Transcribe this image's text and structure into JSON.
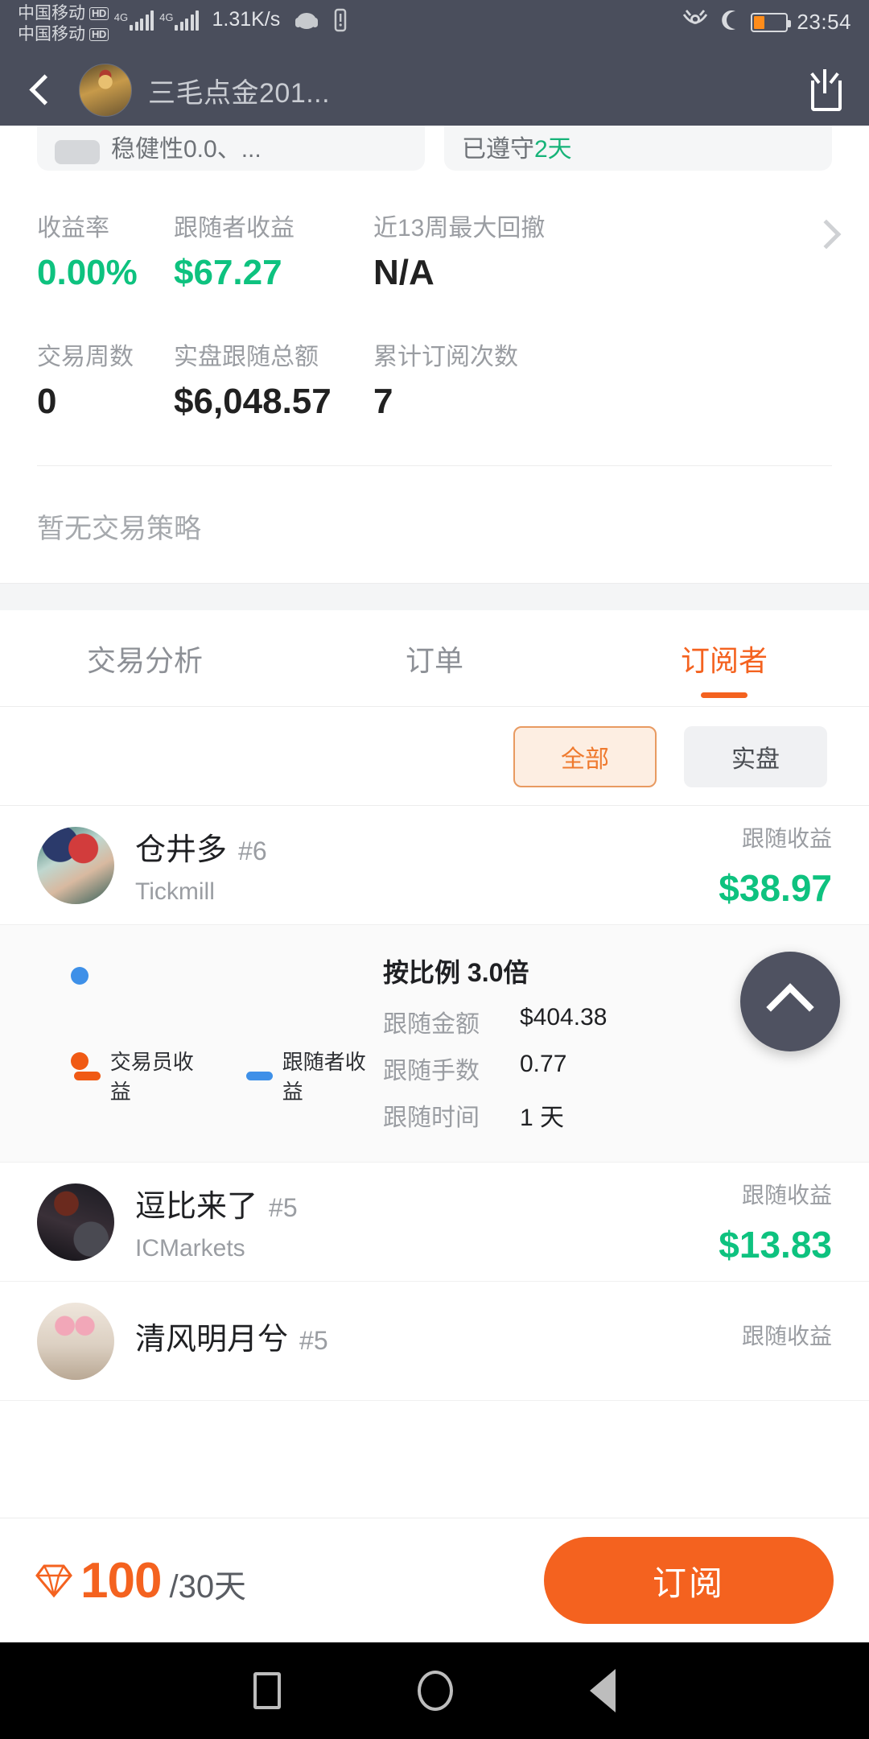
{
  "status_bar": {
    "carrier_1": "中国移动",
    "carrier_2": "中国移动",
    "hd_badge": "HD",
    "net_type_1": "4G",
    "net_type_2": "4G",
    "network_speed": "1.31K/s",
    "clock": "23:54",
    "icons": [
      "headset-icon",
      "vibrate-icon",
      "eye-icon",
      "moon-icon",
      "battery-icon"
    ]
  },
  "app_bar": {
    "title": "三毛点金201...",
    "back_icon": "back-chevron-icon",
    "share_icon": "share-icon",
    "avatar": "trader-avatar"
  },
  "pill_cards": [
    {
      "text": "稳健性0.0、...",
      "accent": ""
    },
    {
      "prefix": "已遵守",
      "accent": "2天"
    }
  ],
  "stats": {
    "row1": [
      {
        "label": "收益率",
        "value": "0.00%",
        "green": true
      },
      {
        "label": "跟随者收益",
        "value": "$67.27",
        "green": true
      },
      {
        "label": "近13周最大回撤",
        "value": "N/A",
        "green": false
      }
    ],
    "row2": [
      {
        "label": "交易周数",
        "value": "0",
        "green": false
      },
      {
        "label": "实盘跟随总额",
        "value": "$6,048.57",
        "green": false
      },
      {
        "label": "累计订阅次数",
        "value": "7",
        "green": false
      }
    ],
    "chevron_icon": "chevron-right-icon"
  },
  "empty_strategy": "暂无交易策略",
  "tabs": [
    {
      "label": "交易分析",
      "active": false
    },
    {
      "label": "订单",
      "active": false
    },
    {
      "label": "订阅者",
      "active": true
    }
  ],
  "filter_chips": [
    {
      "label": "全部",
      "active": true
    },
    {
      "label": "实盘",
      "active": false
    }
  ],
  "subscribers": [
    {
      "name": "仓井多",
      "rank": "#6",
      "broker": "Tickmill",
      "pl_label": "跟随收益",
      "pl_value": "$38.97",
      "expanded": true,
      "detail": {
        "title": "按比例 3.0倍",
        "lines": [
          {
            "label": "跟随金额",
            "value": "$404.38"
          },
          {
            "label": "跟随手数",
            "value": "0.77"
          },
          {
            "label": "跟随时间",
            "value": "1 天"
          }
        ],
        "legend": [
          {
            "label": "交易员收益",
            "color": "#f05a14"
          },
          {
            "label": "跟随者收益",
            "color": "#3e90e8"
          }
        ]
      }
    },
    {
      "name": "逗比来了",
      "rank": "#5",
      "broker": "ICMarkets",
      "pl_label": "跟随收益",
      "pl_value": "$13.83",
      "expanded": false
    },
    {
      "name": "清风明月兮",
      "rank": "#5",
      "broker": "",
      "pl_label": "跟随收益",
      "pl_value": "",
      "expanded": false
    }
  ],
  "fab": {
    "icon": "chevron-up-icon"
  },
  "bottom_bar": {
    "currency_icon": "diamond-icon",
    "price": "100",
    "period": "/30天",
    "subscribe_label": "订阅"
  },
  "nav_bar": {
    "recents_icon": "recents-square-icon",
    "home_icon": "home-circle-icon",
    "back_icon": "back-triangle-icon"
  },
  "colors": {
    "accent_orange": "#f4621f",
    "profit_green": "#0ec27f",
    "appbar_bg": "#4a4e5c"
  }
}
